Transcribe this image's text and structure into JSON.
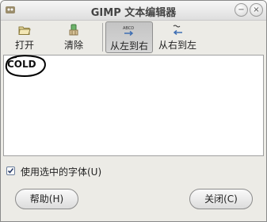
{
  "window": {
    "title": "GIMP 文本编辑器",
    "minimize_glyph": "−",
    "close_glyph": "×"
  },
  "toolbar": {
    "open": {
      "label": "打开",
      "icon": "folder-open-icon"
    },
    "clear": {
      "label": "清除",
      "icon": "clear-icon"
    },
    "ltr": {
      "label": "从左到右",
      "icon": "text-ltr-icon",
      "active": true
    },
    "rtl": {
      "label": "从右到左",
      "icon": "text-rtl-icon",
      "active": false
    }
  },
  "editor": {
    "text": "COLD"
  },
  "options": {
    "use_selected_font": {
      "label": "使用选中的字体(U)",
      "checked": true
    }
  },
  "buttons": {
    "help": "帮助(H)",
    "close": "关闭(C)"
  },
  "colors": {
    "accent_icon_blue": "#3f6fb3",
    "window_bg": "#ecebe6"
  }
}
